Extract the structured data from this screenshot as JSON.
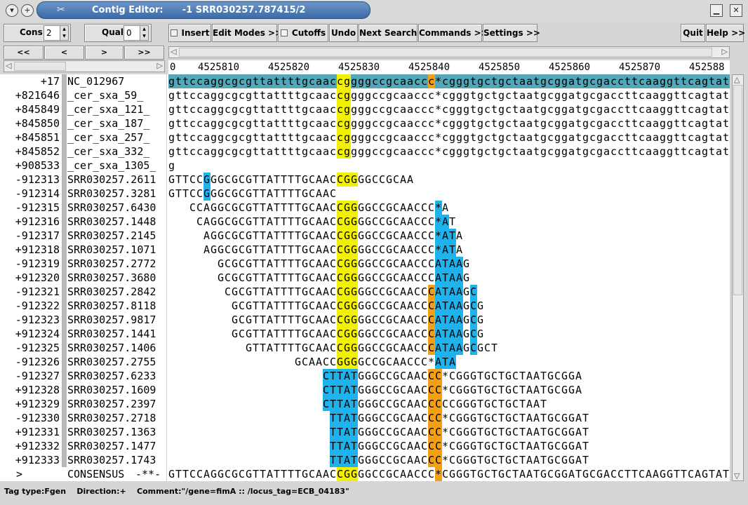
{
  "window": {
    "title": "Contig Editor:      -1 SRR030257.787415/2",
    "icons": [
      "menu-icon",
      "add-icon",
      "logo-icon",
      "minimize-icon",
      "maximize-icon",
      "close-icon"
    ]
  },
  "toolbar": {
    "cons_label": "Cons",
    "cons_value": "2",
    "qual_label": "Qual",
    "qual_value": "0",
    "insert_label": "Insert",
    "edit_modes_label": "Edit Modes >>",
    "cutoffs_label": "Cutoffs",
    "undo_label": "Undo",
    "next_search_label": "Next Search",
    "commands_label": "Commands >>",
    "settings_label": "Settings >>",
    "quit_label": "Quit",
    "help_label": "Help >>"
  },
  "nav": {
    "first_label": "<<",
    "prev_label": "<",
    "next_label": ">",
    "last_label": ">>"
  },
  "ruler": {
    "start": "0",
    "ticks": [
      "4525810",
      "4525820",
      "4525830",
      "4525840",
      "4525850",
      "4525860",
      "4525870",
      "452588"
    ]
  },
  "reads": [
    {
      "num": "+17",
      "name": "NC_012967",
      "seq": "gttccaggcgcgttattttgcaaccggggccgcaaccc*cgggtgctgctaatgcggatgcgaccttcaaggttcagtat"
    },
    {
      "num": "+821646",
      "name": "_cer_sxa_59_",
      "seq": "gttccaggcgcgttattttgcaaccggggccgcaaccc*cgggtgctgctaatgcggatgcgaccttcaaggttcagtat"
    },
    {
      "num": "+845849",
      "name": "_cer_sxa_121_",
      "seq": "gttccaggcgcgttattttgcaaccggggccgcaaccc*cgggtgctgctaatgcggatgcgaccttcaaggttcagtat"
    },
    {
      "num": "+845850",
      "name": "_cer_sxa_187_",
      "seq": "gttccaggcgcgttattttgcaaccggggccgcaaccc*cgggtgctgctaatgcggatgcgaccttcaaggttcagtat"
    },
    {
      "num": "+845851",
      "name": "_cer_sxa_257_",
      "seq": "gttccaggcgcgttattttgcaaccggggccgcaaccc*cgggtgctgctaatgcggatgcgaccttcaaggttcagtat"
    },
    {
      "num": "+845852",
      "name": "_cer_sxa_332_",
      "seq": "gttccaggcgcgttattttgcaaccggggccgcaaccc*cgggtgctgctaatgcggatgcgaccttcaaggttcagtat"
    },
    {
      "num": "+908533",
      "name": "_cer_sxa_1305_",
      "seq": "g"
    },
    {
      "num": "-912313",
      "name": "SRR030257.2611",
      "seq": "GTTCCGGGCGCGTTATTTTGCAACCGGGGCCGCAA"
    },
    {
      "num": "-912314",
      "name": "SRR030257.3281",
      "seq": "GTTCCGGGCGCGTTATTTTGCAAC"
    },
    {
      "num": "-912315",
      "name": "SRR030257.6430",
      "seq": "   CCAGGCGCGTTATTTTGCAACCGGGGCCGCAACCC*A"
    },
    {
      "num": "+912316",
      "name": "SRR030257.1448",
      "seq": "    CAGGCGCGTTATTTTGCAACCGGGGCCGCAACCC*AT"
    },
    {
      "num": "-912317",
      "name": "SRR030257.2145",
      "seq": "     AGGCGCGTTATTTTGCAACCGGGGCCGCAACCC*ATA"
    },
    {
      "num": "+912318",
      "name": "SRR030257.1071",
      "seq": "     AGGCGCGTTATTTTGCAACCGGGGCCGCAACCC*ATA"
    },
    {
      "num": "-912319",
      "name": "SRR030257.2772",
      "seq": "       GCGCGTTATTTTGCAACCGGGGCCGCAACCCATAAG"
    },
    {
      "num": "+912320",
      "name": "SRR030257.3680",
      "seq": "       GCGCGTTATTTTGCAACCGGGGCCGCAACCCATAAG"
    },
    {
      "num": "-912321",
      "name": "SRR030257.2842",
      "seq": "        CGCGTTATTTTGCAACCGGGGCCGCAACCCATAAGC"
    },
    {
      "num": "-912322",
      "name": "SRR030257.8118",
      "seq": "         GCGTTATTTTGCAACCGGGGCCGCAACCCATAAGCG"
    },
    {
      "num": "-912323",
      "name": "SRR030257.9817",
      "seq": "         GCGTTATTTTGCAACCGGGGCCGCAACCCATAAGCG"
    },
    {
      "num": "+912324",
      "name": "SRR030257.1441",
      "seq": "         GCGTTATTTTGCAACCGGGGCCGCAACCCATAAGCG"
    },
    {
      "num": "-912325",
      "name": "SRR030257.1406",
      "seq": "           GTTATTTTGCAACCGGGGCCGCAACCCATAAGCGCT"
    },
    {
      "num": "-912326",
      "name": "SRR030257.2755",
      "seq": "                  GCAACCGGGGCCGCAACCC*ATA"
    },
    {
      "num": "-912327",
      "name": "SRR030257.6233",
      "seq": "                      CTTATGGGCCGCAACCC*CGGGTGCTGCTAATGCGGA"
    },
    {
      "num": "+912328",
      "name": "SRR030257.1609",
      "seq": "                      CTTATGGGCCGCAACCC*CGGGTGCTGCTAATGCGGA"
    },
    {
      "num": "+912329",
      "name": "SRR030257.2397",
      "seq": "                      CTTATGGGCCGCAACCCCCGGGTGCTGCTAAT"
    },
    {
      "num": "-912330",
      "name": "SRR030257.2718",
      "seq": "                       TTATGGGCCGCAACCC*CGGGTGCTGCTAATGCGGAT"
    },
    {
      "num": "+912331",
      "name": "SRR030257.1363",
      "seq": "                       TTATGGGCCGCAACCC*CGGGTGCTGCTAATGCGGAT"
    },
    {
      "num": "+912332",
      "name": "SRR030257.1477",
      "seq": "                       TTATGGGCCGCAACCC*CGGGTGCTGCTAATGCGGAT"
    },
    {
      "num": "+912333",
      "name": "SRR030257.1743",
      "seq": "                       TTATGGGCCGCAACCC*CGGGTGCTGCTAATGCGGAT"
    }
  ],
  "consensus": {
    "num": ">",
    "name": "CONSENSUS",
    "flag": "-**-",
    "seq": "GTTCCAGGCGCGTTATTTTGCAACCGGGGCCGCAACCC*CGGGTGCTGCTAATGCGGATGCGACCTTCAAGGTTCAGTAT"
  },
  "status": {
    "text": "Tag type:Fgen    Direction:+    Comment:\"/gene=fimA :: /locus_tag=ECB_04183\""
  },
  "colors": {
    "highlight_yellow": "#f2f200",
    "highlight_orange": "#f4a014",
    "highlight_cyan": "#1fb3ee",
    "reference_teal": "#53a7b8",
    "title_blue": "#4a78b4"
  }
}
